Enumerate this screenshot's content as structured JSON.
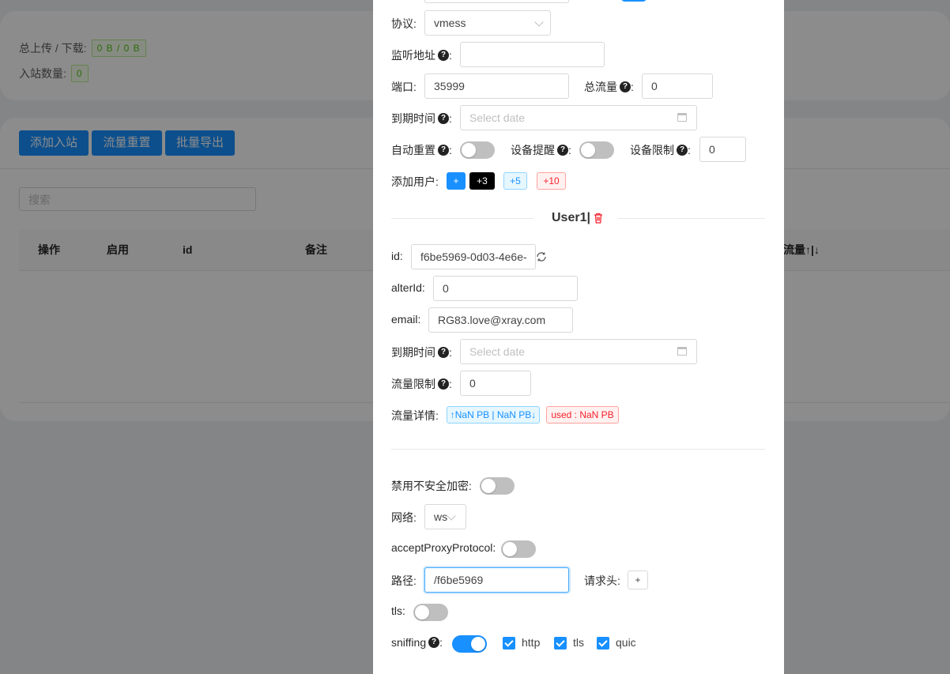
{
  "background": {
    "stats": {
      "traffic_label": "总上传 / 下载:",
      "traffic_value": "0 B / 0 B",
      "inbound_count_label": "入站数量:",
      "inbound_count_value": "0"
    },
    "toolbar": {
      "add_inbound": "添加入站",
      "reset_traffic": "流量重置",
      "batch_export": "批量导出"
    },
    "search": {
      "placeholder": "搜索"
    },
    "table": {
      "columns": [
        "操作",
        "启用",
        "id",
        "备注",
        "流量↑|↓"
      ]
    }
  },
  "form": {
    "protocol": {
      "label": "协议",
      "value": "vmess"
    },
    "listen": {
      "label": "监听地址",
      "value": ""
    },
    "port": {
      "label": "端口",
      "value": "35999"
    },
    "total_traffic": {
      "label": "总流量",
      "value": "0"
    },
    "expiry": {
      "label": "到期时间",
      "placeholder": "Select date"
    },
    "auto_reset": {
      "label": "自动重置",
      "on": false
    },
    "device_alert": {
      "label": "设备提醒",
      "on": false
    },
    "device_limit": {
      "label": "设备限制",
      "value": "0"
    },
    "add_user": {
      "label": "添加用户",
      "buttons": [
        "+",
        "+3",
        "+5",
        "+10"
      ]
    },
    "user": {
      "title": "User1|",
      "id": {
        "label": "id",
        "value": "f6be5969-0d03-4e6e-"
      },
      "alter_id": {
        "label": "alterId",
        "value": "0"
      },
      "email": {
        "label": "email",
        "value": "RG83.love@xray.com"
      },
      "expiry": {
        "label": "到期时间",
        "placeholder": "Select date"
      },
      "traffic_limit": {
        "label": "流量限制",
        "value": "0"
      },
      "traffic_detail": {
        "label": "流量详情",
        "updown": "↑NaN PB | NaN PB↓",
        "used": "used : NaN PB"
      }
    },
    "disable_insecure": {
      "label": "禁用不安全加密",
      "on": false
    },
    "network": {
      "label": "网络",
      "value": "ws"
    },
    "accept_proxy": {
      "label": "acceptProxyProtocol",
      "on": false
    },
    "path": {
      "label": "路径",
      "value": "/f6be5969"
    },
    "headers": {
      "label": "请求头",
      "button": "+"
    },
    "tls": {
      "label": "tls",
      "on": false
    },
    "sniffing": {
      "label": "sniffing",
      "on": true,
      "options": [
        "http",
        "tls",
        "quic"
      ]
    }
  },
  "colors": {
    "primary": "#1890ff",
    "mask": "rgba(0,0,0,0.45)",
    "danger": "#f5222d"
  }
}
